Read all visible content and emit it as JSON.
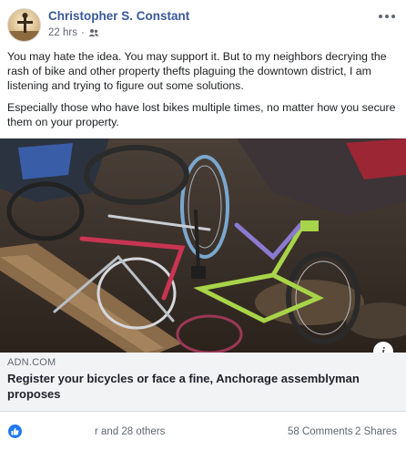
{
  "post": {
    "author": "Christopher S. Constant",
    "time": "22 hrs",
    "separator": "·",
    "audience_icon": "friends-icon",
    "body": [
      "You may hate the idea. You may support it. But to my neighbors decrying the rash of bike and other property thefts plaguing the downtown district, I am listening and trying to figure out some solutions.",
      "Especially those who have lost bikes multiple times, no matter how you secure them on your property."
    ]
  },
  "link": {
    "domain": "ADN.COM",
    "headline": "Register your bicycles or face a fine, Anchorage assemblyman proposes",
    "info_label": "i"
  },
  "footer": {
    "reactions": "r and 28 others",
    "comments": "58 Comments",
    "shares": "2 Shares"
  },
  "colors": {
    "author_link": "#385898",
    "like_blue": "#2078f4",
    "link_bg": "#f2f3f5",
    "meta_gray": "#616770"
  }
}
